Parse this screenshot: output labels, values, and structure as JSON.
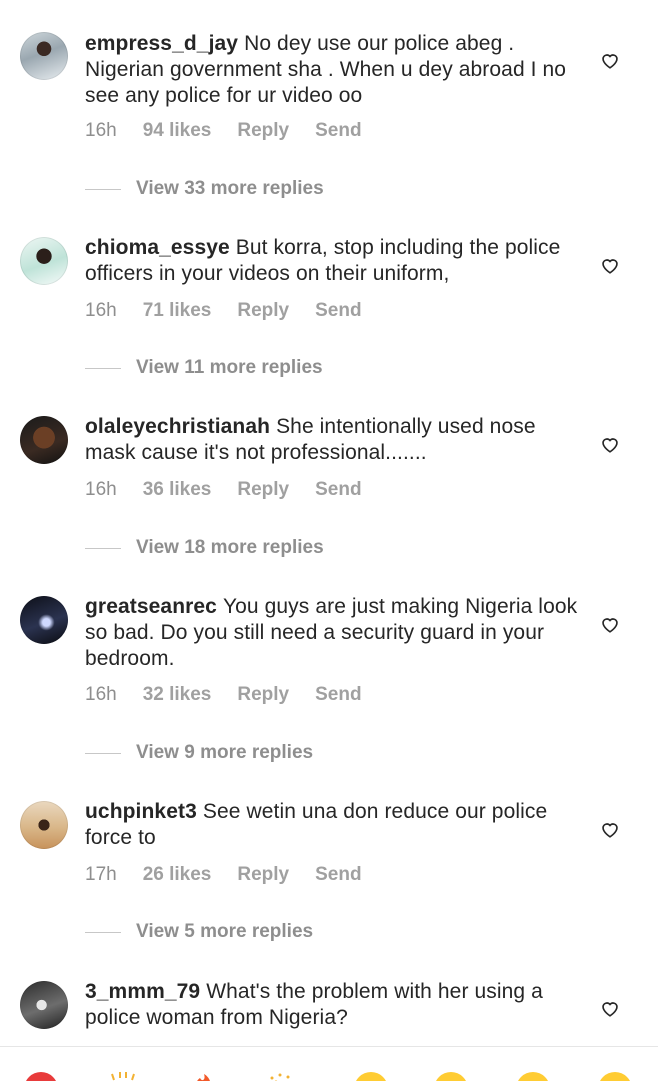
{
  "comments": [
    {
      "username": "empress_d_jay",
      "text": "No dey use our police abeg . Nigerian government sha . When u dey abroad I no see any police for ur video oo",
      "time": "16h",
      "likes": "94 likes",
      "reply_label": "Reply",
      "send_label": "Send",
      "view_replies": "View 33 more replies"
    },
    {
      "username": "chioma_essye",
      "text": "But korra,  stop including the police officers in your videos on their uniform,",
      "time": "16h",
      "likes": "71 likes",
      "reply_label": "Reply",
      "send_label": "Send",
      "view_replies": "View 11 more replies"
    },
    {
      "username": "olaleyechristianah",
      "text": "She intentionally used nose mask cause it's not professional.......",
      "time": "16h",
      "likes": "36 likes",
      "reply_label": "Reply",
      "send_label": "Send",
      "view_replies": "View 18 more replies"
    },
    {
      "username": "greatseanrec",
      "text": "You guys are just making Nigeria look so bad. Do you still need a security guard in your bedroom.",
      "time": "16h",
      "likes": "32 likes",
      "reply_label": "Reply",
      "send_label": "Send",
      "view_replies": "View 9 more replies"
    },
    {
      "username": "uchpinket3",
      "text": "See wetin una don reduce our police force to",
      "time": "17h",
      "likes": "26 likes",
      "reply_label": "Reply",
      "send_label": "Send",
      "view_replies": "View 5 more replies"
    },
    {
      "username": "3_mmm_79",
      "text": "What's the problem with her using a police woman from Nigeria?"
    }
  ],
  "icons": {
    "like": "heart-outline-icon",
    "bottom_row": [
      "red-heart-emoji",
      "raised-hands-emoji",
      "fire-emoji",
      "party-emoji",
      "face-emoji",
      "face-emoji",
      "face-emoji",
      "face-emoji"
    ]
  },
  "colors": {
    "text": "#262626",
    "meta": "#8e8e8e",
    "background": "#ffffff"
  }
}
